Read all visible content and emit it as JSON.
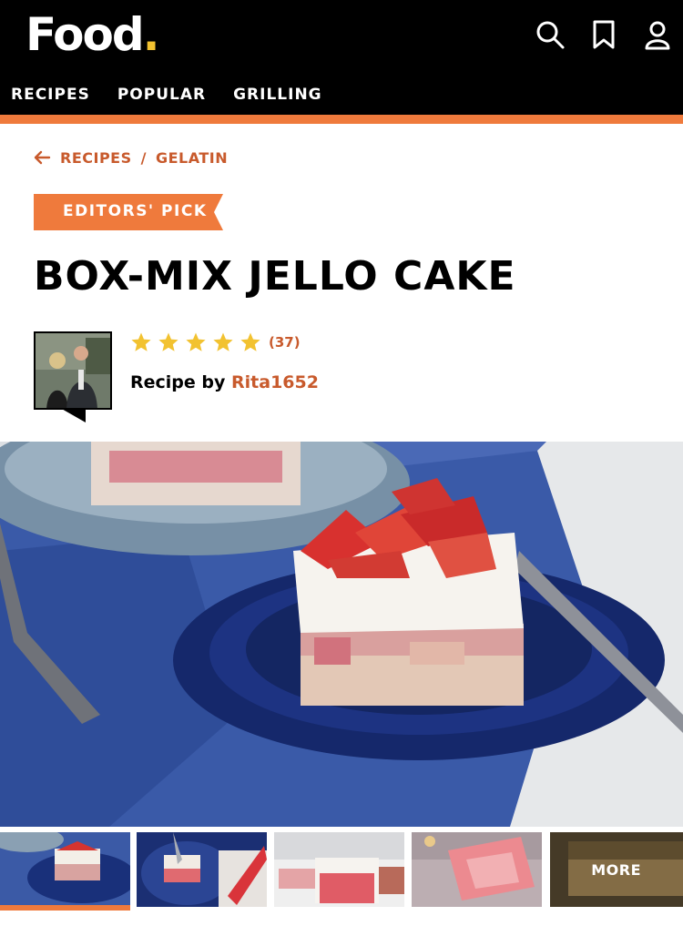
{
  "header": {
    "logo_text": "Food",
    "logo_dot": ".",
    "nav": [
      "RECIPES",
      "POPULAR",
      "GRILLING"
    ],
    "icons": [
      "search-icon",
      "bookmark-icon",
      "account-icon"
    ]
  },
  "breadcrumb": {
    "parent": "RECIPES",
    "separator": "/",
    "current": "GELATIN"
  },
  "badge": "EDITORS' PICK",
  "title": "BOX-MIX JELLO CAKE",
  "rating": {
    "stars": 5,
    "count": "(37)"
  },
  "byline": {
    "prefix": "Recipe by",
    "author": "Rita1652"
  },
  "gallery": {
    "more_label": "MORE",
    "active_index": 0
  },
  "colors": {
    "brand_orange": "#ef7a3c",
    "link_orange": "#c85a2c",
    "star_yellow": "#f2c230"
  }
}
